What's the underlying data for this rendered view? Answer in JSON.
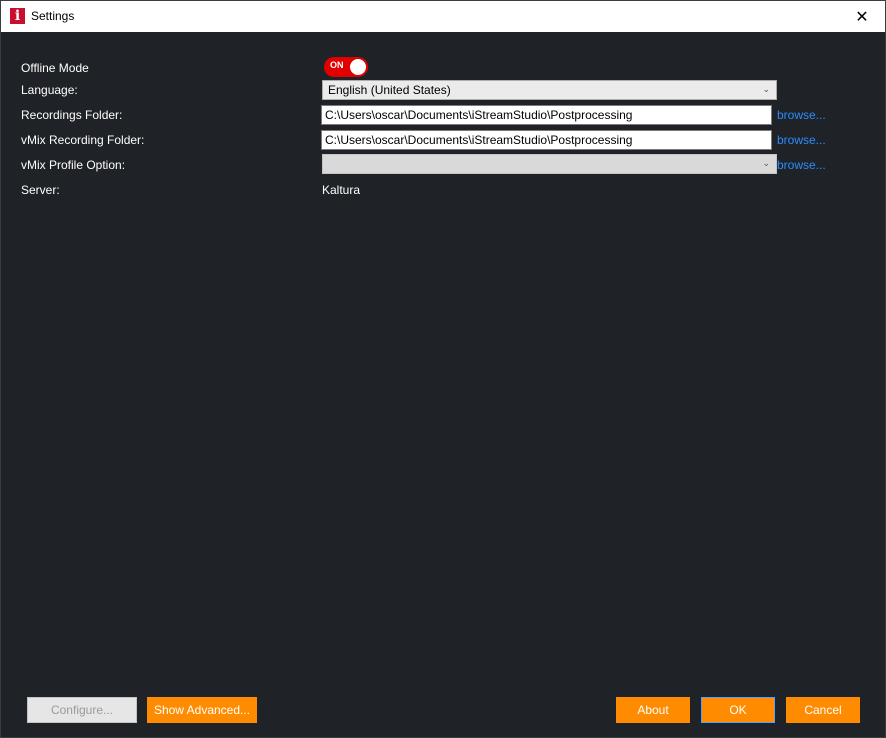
{
  "window": {
    "title": "Settings",
    "app_icon_glyph": "i",
    "close_glyph": "✕"
  },
  "form": {
    "offline_mode": {
      "label": "Offline Mode",
      "toggle_text": "ON",
      "enabled": true
    },
    "language": {
      "label": "Language:",
      "value": "English (United States)"
    },
    "recordings_folder": {
      "label": "Recordings Folder:",
      "value": "C:\\Users\\oscar\\Documents\\iStreamStudio\\Postprocessing",
      "browse": "browse..."
    },
    "vmix_recording_folder": {
      "label": "vMix Recording Folder:",
      "value": "C:\\Users\\oscar\\Documents\\iStreamStudio\\Postprocessing",
      "browse": "browse..."
    },
    "vmix_profile_option": {
      "label": "vMix Profile Option:",
      "value": "",
      "browse": "browse..."
    },
    "server": {
      "label": "Server:",
      "value": "Kaltura"
    }
  },
  "buttons": {
    "configure": "Configure...",
    "show_advanced": "Show Advanced...",
    "about": "About",
    "ok": "OK",
    "cancel": "Cancel"
  },
  "colors": {
    "background": "#1f2226",
    "accent": "#ff8c00",
    "toggle_on": "#e00000",
    "link": "#2b8cff"
  },
  "icons": {
    "app": "istream-logo-icon",
    "close": "close-icon",
    "dropdown": "chevron-down-icon"
  }
}
